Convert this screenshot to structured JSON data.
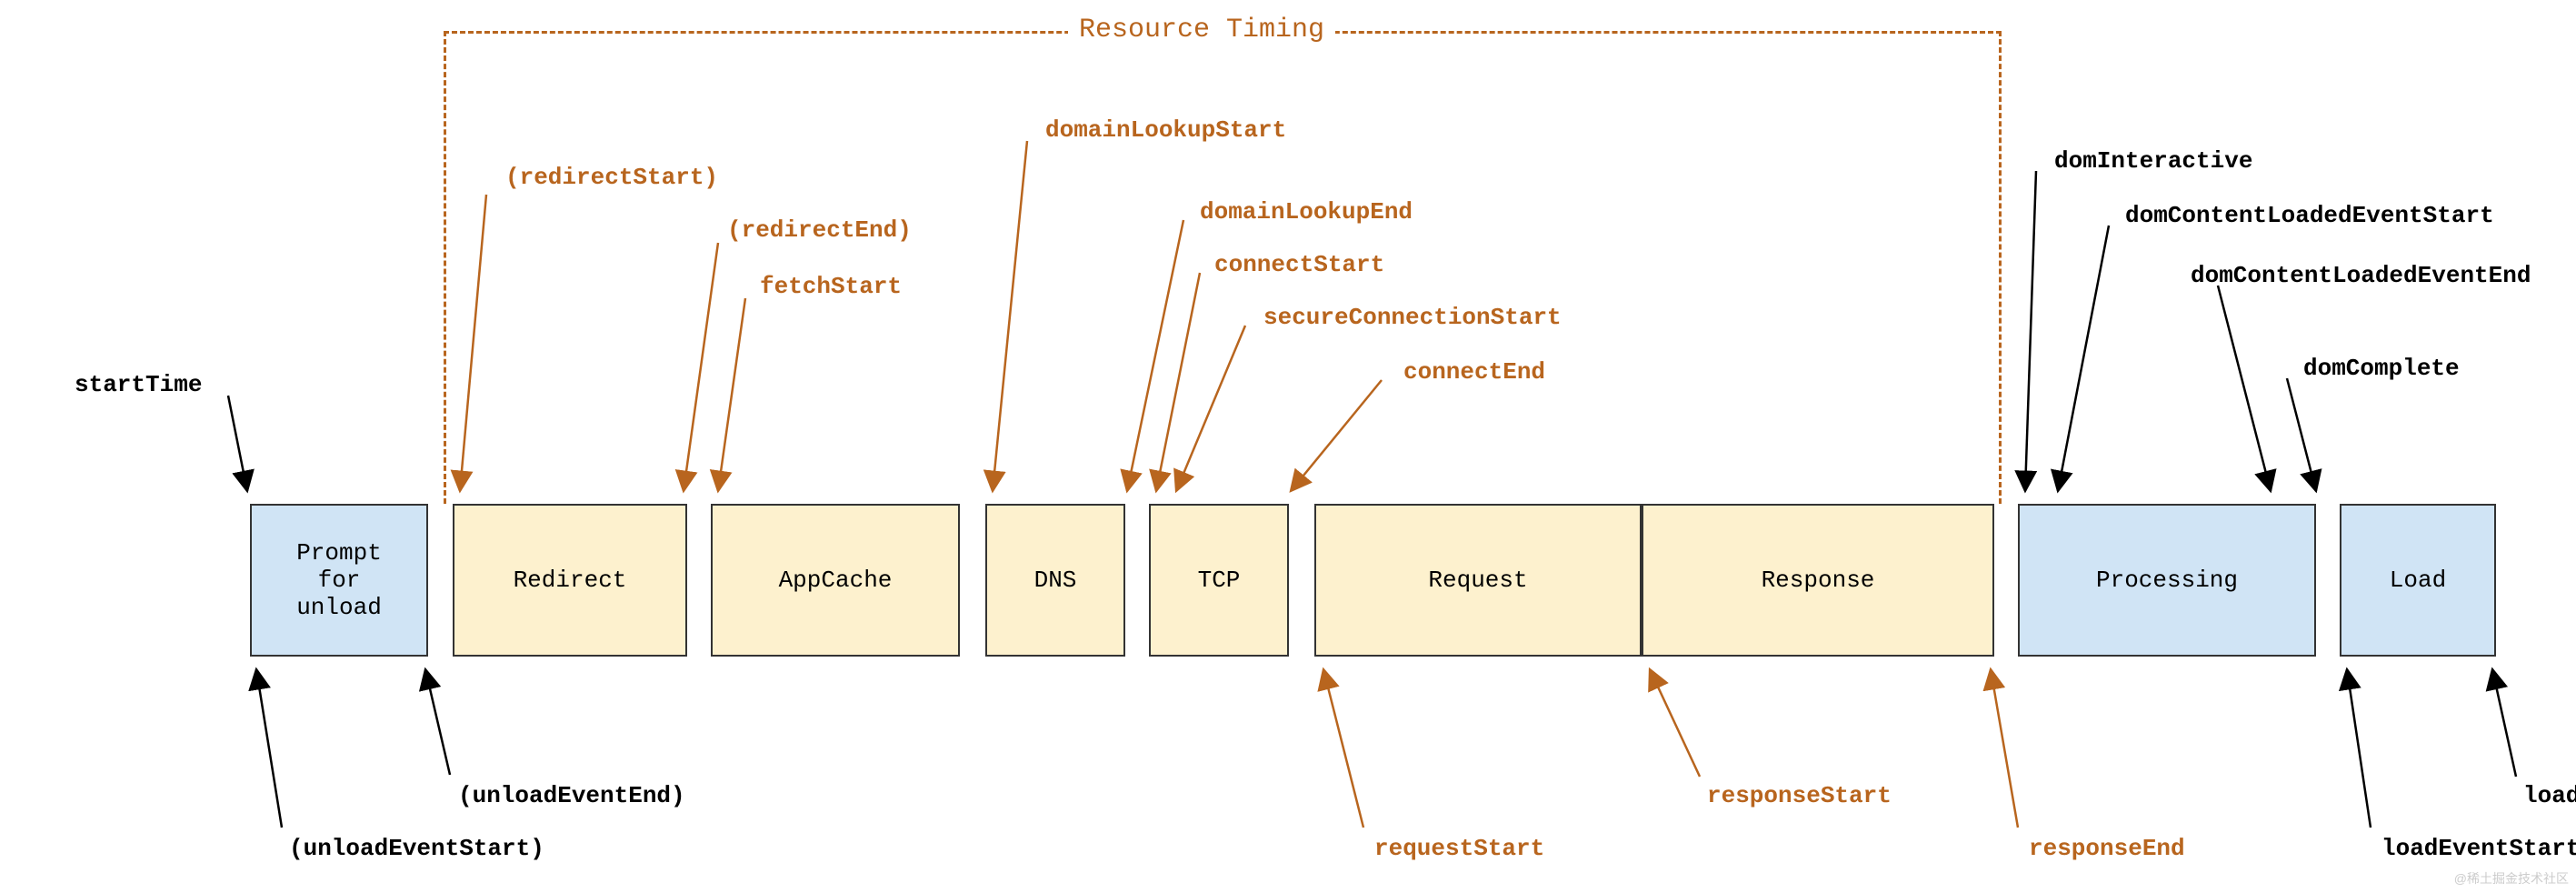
{
  "title": "Resource Timing",
  "phases": {
    "prompt_unload": "Prompt\nfor\nunload",
    "redirect": "Redirect",
    "appcache": "AppCache",
    "dns": "DNS",
    "tcp": "TCP",
    "request": "Request",
    "response": "Response",
    "processing": "Processing",
    "load": "Load"
  },
  "events": {
    "startTime": "startTime",
    "unloadEventStart": "(unloadEventStart)",
    "unloadEventEnd": "(unloadEventEnd)",
    "redirectStart": "(redirectStart)",
    "redirectEnd": "(redirectEnd)",
    "fetchStart": "fetchStart",
    "domainLookupStart": "domainLookupStart",
    "domainLookupEnd": "domainLookupEnd",
    "connectStart": "connectStart",
    "secureConnectionStart": "secureConnectionStart",
    "connectEnd": "connectEnd",
    "requestStart": "requestStart",
    "responseStart": "responseStart",
    "responseEnd": "responseEnd",
    "domInteractive": "domInteractive",
    "domContentLoadedEventStart": "domContentLoadedEventStart",
    "domContentLoadedEventEnd": "domContentLoadedEventEnd",
    "domComplete": "domComplete",
    "loadEventStart": "loadEventStart",
    "loadEventEnd": "loadEventEnd"
  },
  "colors": {
    "brown": "#b8651e",
    "blue": "#d0e4f5",
    "yellow": "#fdf1ce"
  },
  "watermark": "@稀土掘金技术社区"
}
